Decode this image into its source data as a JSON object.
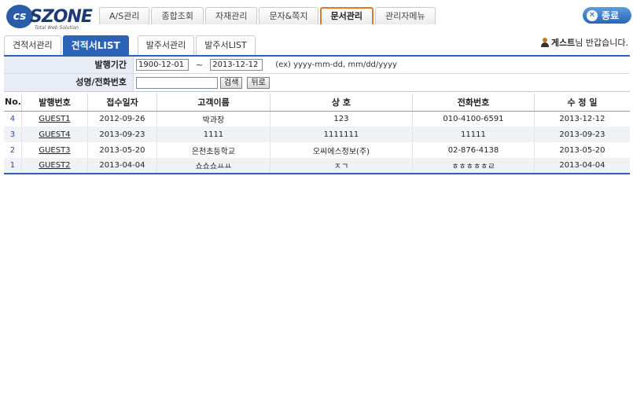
{
  "logo": {
    "brand": "SZONE",
    "tagline": "Total Web Solution"
  },
  "top_menu": [
    {
      "label": "A/S관리",
      "active": false
    },
    {
      "label": "종합조회",
      "active": false
    },
    {
      "label": "자재관리",
      "active": false
    },
    {
      "label": "문자&쪽지",
      "active": false
    },
    {
      "label": "문서관리",
      "active": true
    },
    {
      "label": "관리자메뉴",
      "active": false
    }
  ],
  "exit_label": "종료",
  "sub_tabs": [
    {
      "label": "견적서관리",
      "active": false
    },
    {
      "label": "견적서LIST",
      "active": true
    },
    {
      "label": "발주서관리",
      "active": false
    },
    {
      "label": "발주서LIST",
      "active": false
    }
  ],
  "welcome": {
    "name": "게스트",
    "suffix": "님 반갑습니다."
  },
  "search": {
    "period_label": "발행기간",
    "date_from": "1900-12-01",
    "tilde": "~",
    "date_to": "2013-12-12",
    "date_hint": "(ex) yyyy-mm-dd, mm/dd/yyyy",
    "name_label": "성명/전화번호",
    "name_value": "",
    "search_button": "검색",
    "back_button": "뒤로"
  },
  "table": {
    "headers": [
      "No.",
      "발행번호",
      "접수일자",
      "고객이름",
      "상 호",
      "전화번호",
      "수 정 일"
    ],
    "rows": [
      {
        "no": "4",
        "code": "GUEST1",
        "received": "2012-09-26",
        "customer": "박과장",
        "company": "123",
        "phone": "010-4100-6591",
        "modified": "2013-12-12"
      },
      {
        "no": "3",
        "code": "GUEST4",
        "received": "2013-09-23",
        "customer": "1111",
        "company": "1111111",
        "phone": "11111",
        "modified": "2013-09-23"
      },
      {
        "no": "2",
        "code": "GUEST3",
        "received": "2013-05-20",
        "customer": "은천초등학교",
        "company": "오씨에스정보(주)",
        "phone": "02-876-4138",
        "modified": "2013-05-20"
      },
      {
        "no": "1",
        "code": "GUEST2",
        "received": "2013-04-04",
        "customer": "쇼쇼쇼ㅛㅛ",
        "company": "ㅈㄱ",
        "phone": "ㅎㅎㅎㅎㅎㄹ",
        "modified": "2013-04-04"
      }
    ]
  },
  "colors": {
    "accent": "#2b63b7",
    "active_menu_border": "#e07a2a",
    "label_bg": "#e8ecf4"
  }
}
